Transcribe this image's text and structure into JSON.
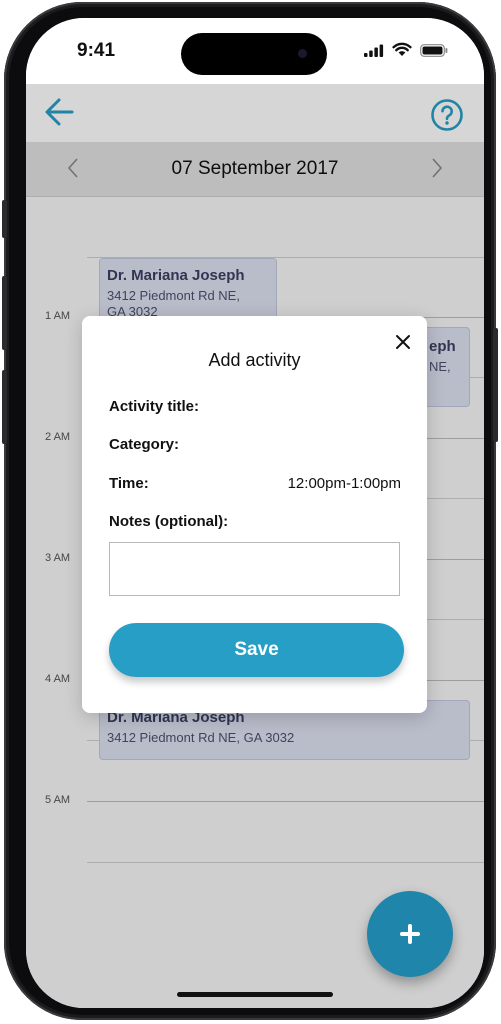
{
  "status_bar": {
    "time": "9:41",
    "icons": [
      "signal-icon",
      "wifi-icon",
      "battery-icon"
    ]
  },
  "header": {
    "back_icon": "arrow-left-icon",
    "help_icon": "question-circle-icon",
    "accent_color": "#269ec5"
  },
  "date_nav": {
    "date": "07 September 2017",
    "prev_icon": "chevron-left-icon",
    "next_icon": "chevron-right-icon"
  },
  "calendar": {
    "hours": [
      "1 AM",
      "2 AM",
      "3 AM",
      "4 AM",
      "5 AM"
    ],
    "events": [
      {
        "title": "Dr. Mariana Joseph",
        "address_line1": "3412 Piedmont Rd NE,",
        "address_line2": "GA 3032"
      },
      {
        "title": "eph",
        "address_line1": "NE,"
      },
      {
        "title": "Dr. Mariana Joseph",
        "address_line1": "3412 Piedmont Rd NE, GA 3032"
      }
    ]
  },
  "modal": {
    "title": "Add activity",
    "close_icon": "close-icon",
    "fields": {
      "activity_title": "Activity title:",
      "category": "Category:",
      "time_label": "Time:",
      "time_value": "12:00pm-1:00pm",
      "notes": "Notes (optional):"
    },
    "notes_value": "",
    "save_label": "Save",
    "save_color": "#269ec5"
  },
  "fab": {
    "icon": "plus-icon",
    "color": "#1f85ab"
  }
}
